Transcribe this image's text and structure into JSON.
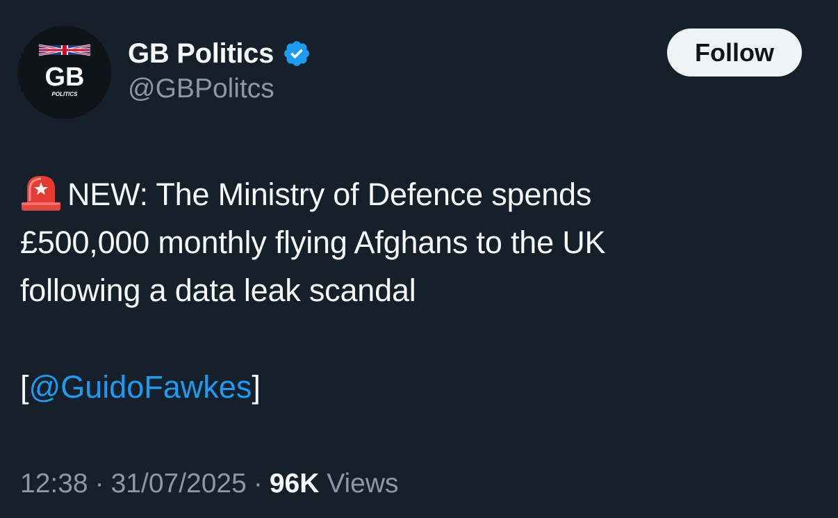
{
  "author": {
    "display_name": "GB Politics",
    "handle": "@GBPolitcs",
    "verified": true,
    "avatar": {
      "logo_text": "GB",
      "logo_subtext": "POLITICS"
    }
  },
  "actions": {
    "follow_label": "Follow"
  },
  "tweet": {
    "emoji_icon": "police-siren-emoji",
    "lines": [
      "NEW: The Ministry of Defence spends",
      "£500,000 monthly flying Afghans to the UK",
      "following a data leak scandal"
    ],
    "mention_open": "[",
    "mention": "@GuidoFawkes",
    "mention_close": "]"
  },
  "meta": {
    "time": "12:38",
    "separator": "·",
    "date": "31/07/2025",
    "views_count": "96K",
    "views_label": "Views"
  },
  "colors": {
    "background": "#15202b",
    "primary_text": "#f7f9f9",
    "secondary_text": "#8b98a5",
    "link": "#1d9bf0",
    "verified_badge": "#1d9bf0",
    "follow_button_bg": "#eff3f4"
  }
}
